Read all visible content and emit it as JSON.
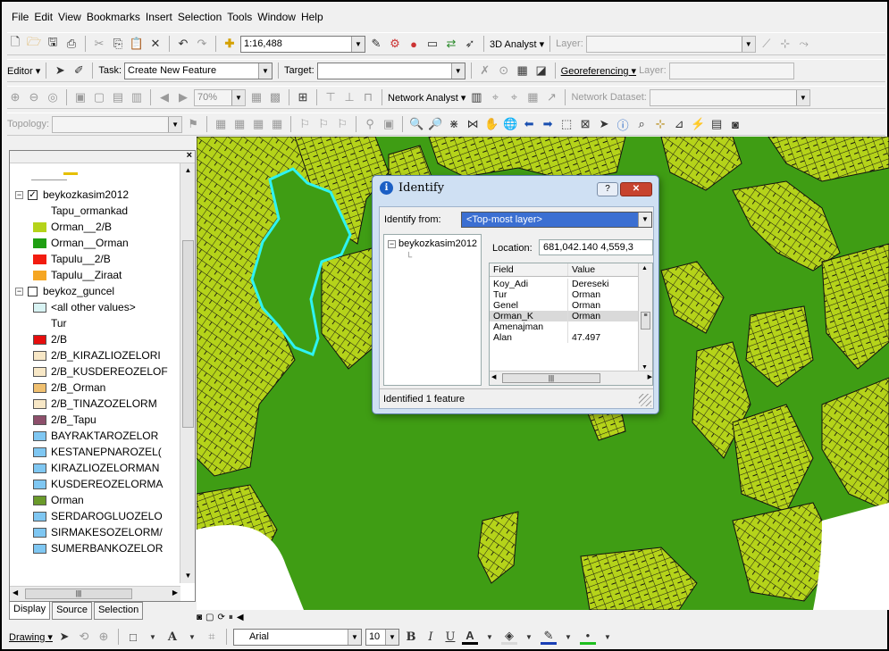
{
  "menu": [
    "File",
    "Edit",
    "View",
    "Bookmarks",
    "Insert",
    "Selection",
    "Tools",
    "Window",
    "Help"
  ],
  "standard_toolbar": {
    "scale": "1:16,488",
    "analyst_3d": "3D Analyst ▾",
    "layer_label": "Layer:"
  },
  "editor_toolbar": {
    "editor": "Editor ▾",
    "task_label": "Task:",
    "task_value": "Create New Feature",
    "target_label": "Target:",
    "georef": "Georeferencing ▾",
    "layer_label": "Layer:"
  },
  "network_toolbar": {
    "zoom_value": "70%",
    "network_analyst": "Network Analyst ▾",
    "network_dataset_label": "Network Dataset:"
  },
  "topology_toolbar": {
    "topology_label": "Topology:"
  },
  "toc": {
    "layers": [
      {
        "kind": "layer",
        "checked": true,
        "label": "beykozkasim2012"
      },
      {
        "kind": "field",
        "label": "Tapu_ormankad"
      },
      {
        "kind": "legend",
        "color": "#b5d31a",
        "label": "Orman__2/B"
      },
      {
        "kind": "legend",
        "color": "#1f9f12",
        "label": "Orman__Orman"
      },
      {
        "kind": "legend",
        "color": "#f21c10",
        "label": "Tapulu__2/B"
      },
      {
        "kind": "legend",
        "color": "#f5a623",
        "label": "Tapulu__Ziraat"
      },
      {
        "kind": "layer",
        "checked": false,
        "label": "beykoz_guncel"
      },
      {
        "kind": "legend",
        "color": "#d8f3f3",
        "label": "<all other values>"
      },
      {
        "kind": "field",
        "label": "Tur"
      },
      {
        "kind": "legend",
        "color": "#e60d0d",
        "label": "2/B"
      },
      {
        "kind": "legend",
        "color": "#f7e7c6",
        "label": "2/B_KIRAZLIOZELORI"
      },
      {
        "kind": "legend",
        "color": "#f7e7c6",
        "label": "2/B_KUSDEREOZELOF"
      },
      {
        "kind": "legend",
        "color": "#f0c070",
        "label": "2/B_Orman"
      },
      {
        "kind": "legend",
        "color": "#f7e7c6",
        "label": "2/B_TINAZOZELORM"
      },
      {
        "kind": "legend",
        "color": "#8d4f6b",
        "label": "2/B_Tapu"
      },
      {
        "kind": "legend",
        "color": "#7fc7f2",
        "label": "BAYRAKTAROZELOR"
      },
      {
        "kind": "legend",
        "color": "#7fc7f2",
        "label": "KESTANEPNAROZEL("
      },
      {
        "kind": "legend",
        "color": "#7fc7f2",
        "label": "KIRAZLIOZELORMAN"
      },
      {
        "kind": "legend",
        "color": "#7fc7f2",
        "label": "KUSDEREOZELORMA"
      },
      {
        "kind": "legend",
        "color": "#6a9a2a",
        "label": "Orman"
      },
      {
        "kind": "legend",
        "color": "#7fc7f2",
        "label": "SERDAROGLUOZELO"
      },
      {
        "kind": "legend",
        "color": "#7fc7f2",
        "label": "SIRMAKESOZELORM/"
      },
      {
        "kind": "legend",
        "color": "#7fc7f2",
        "label": "SUMERBANKOZELOR"
      }
    ],
    "tabs": [
      "Display",
      "Source",
      "Selection"
    ]
  },
  "identify": {
    "title": "Identify",
    "identify_from_label": "Identify from:",
    "identify_from_value": "<Top-most layer>",
    "tree_layer": "beykozkasim2012",
    "location_label": "Location:",
    "location_value": "681,042.140  4,559,3",
    "columns": [
      "Field",
      "Value"
    ],
    "rows": [
      {
        "field": "Koy_Adi",
        "value": "Dereseki"
      },
      {
        "field": "Tur",
        "value": "Orman"
      },
      {
        "field": "Genel",
        "value": "Orman"
      },
      {
        "field": "Orman_K",
        "value": "Orman"
      },
      {
        "field": "Amenajman",
        "value": ""
      },
      {
        "field": "Alan",
        "value": "47.497"
      }
    ],
    "status": "Identified 1 feature"
  },
  "drawing_toolbar": {
    "drawing": "Drawing ▾",
    "font": "Arial",
    "font_size": "10",
    "bold": "B",
    "italic": "I",
    "underline": "U",
    "text_color_glyph": "A"
  },
  "colors": {
    "map_green": "#3f9d14",
    "parcel_yellow": "#b5d31a",
    "highlight_cyan": "#2ef3f3"
  }
}
